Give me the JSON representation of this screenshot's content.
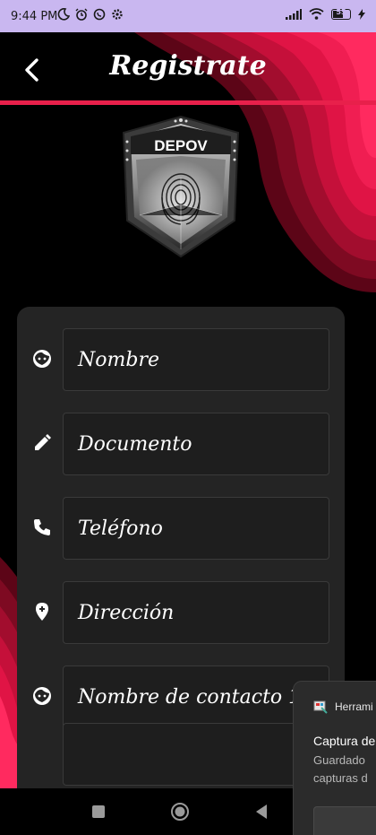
{
  "status_bar": {
    "time": "9:44 PM",
    "icons_left": [
      "moon-icon",
      "alarm-icon",
      "whatsapp-icon",
      "settings-icon"
    ],
    "icons_right": [
      "signal-icon",
      "wifi-icon",
      "battery-icon",
      "charging-icon"
    ],
    "battery_level": "55",
    "background": "#c9b7f0"
  },
  "header": {
    "title": "Registrate",
    "accent_color": "#e8204b"
  },
  "logo": {
    "text": "DEPOV",
    "icon": "fingerprint-shield-logo"
  },
  "form": {
    "fields": [
      {
        "icon": "face-icon",
        "label": "Nombre"
      },
      {
        "icon": "pencil-icon",
        "label": "Documento"
      },
      {
        "icon": "phone-icon",
        "label": "Teléfono"
      },
      {
        "icon": "location-add-icon",
        "label": "Dirección"
      },
      {
        "icon": "face-icon",
        "label": "Nombre de contacto 1"
      }
    ]
  },
  "nav_bar": {
    "buttons": [
      "recents-button",
      "home-button",
      "back-button"
    ]
  },
  "notification": {
    "app_name": "Herrami",
    "title": "Captura de",
    "body_line1": "Guardado",
    "body_line2": "capturas d"
  }
}
